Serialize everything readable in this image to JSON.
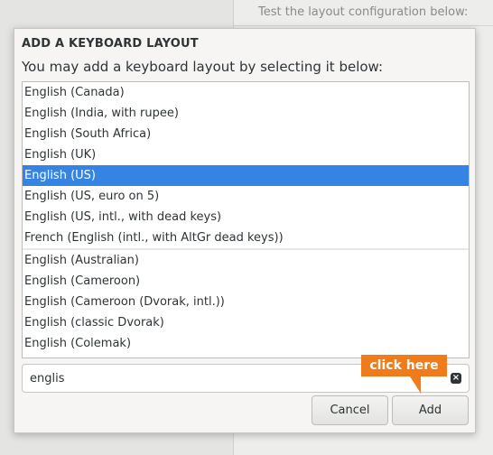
{
  "background": {
    "right_text": "Test the layout configuration below:"
  },
  "dialog": {
    "title": "ADD A KEYBOARD LAYOUT",
    "subtitle": "You may add a keyboard layout by selecting it below:",
    "list_top": [
      {
        "label": "English (Canada)",
        "selected": false
      },
      {
        "label": "English (India, with rupee)",
        "selected": false
      },
      {
        "label": "English (South Africa)",
        "selected": false
      },
      {
        "label": "English (UK)",
        "selected": false
      },
      {
        "label": "English (US)",
        "selected": true
      },
      {
        "label": "English (US, euro on 5)",
        "selected": false
      },
      {
        "label": "English (US, intl., with dead keys)",
        "selected": false
      },
      {
        "label": "French (English (intl., with AltGr dead keys))",
        "selected": false
      }
    ],
    "list_bottom": [
      {
        "label": "English (Australian)",
        "selected": false
      },
      {
        "label": "English (Cameroon)",
        "selected": false
      },
      {
        "label": "English (Cameroon (Dvorak, intl.))",
        "selected": false
      },
      {
        "label": "English (classic Dvorak)",
        "selected": false
      },
      {
        "label": "English (Colemak)",
        "selected": false
      }
    ],
    "search": {
      "value": "englis"
    },
    "buttons": {
      "cancel": "Cancel",
      "add": "Add"
    },
    "callout": "click here",
    "colors": {
      "selection": "#3584e4",
      "callout": "#f07b1a"
    }
  }
}
